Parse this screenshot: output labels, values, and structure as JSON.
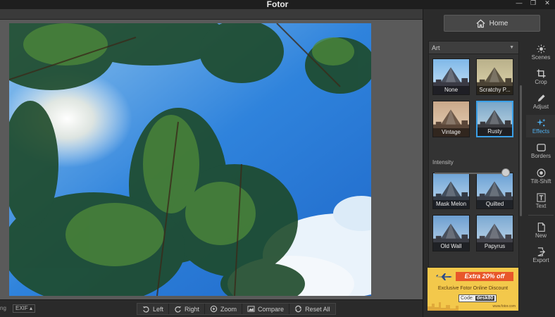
{
  "window": {
    "title": "Fotor",
    "controls": [
      "—",
      "❐",
      "✕"
    ]
  },
  "home": {
    "label": "Home"
  },
  "effects_panel": {
    "category": "Art",
    "intensity_label": "Intensity",
    "intensity": 0.95,
    "thumbnails": [
      {
        "label": "None",
        "tone": "none",
        "selected": false
      },
      {
        "label": "Scratchy P...",
        "tone": "scratchy",
        "selected": false
      },
      {
        "label": "Vintage",
        "tone": "vintage",
        "selected": false
      },
      {
        "label": "Rusty",
        "tone": "rusty",
        "selected": true
      },
      {
        "label": "Mask Melon",
        "tone": "melon",
        "selected": false
      },
      {
        "label": "Quilted",
        "tone": "quilted",
        "selected": false
      },
      {
        "label": "Old Wall",
        "tone": "oldwall",
        "selected": false
      },
      {
        "label": "Papyrus",
        "tone": "papyrus",
        "selected": false
      }
    ]
  },
  "ad": {
    "headline": "Extra 20% off",
    "subtext": "Exclusive Fotor Online Discount",
    "code_label": "Code:",
    "code_value": "desk80",
    "url": "www.fotor.com"
  },
  "sidenav": [
    {
      "label": "Scenes",
      "icon": "sun-icon",
      "active": false
    },
    {
      "label": "Crop",
      "icon": "crop-icon",
      "active": false
    },
    {
      "label": "Adjust",
      "icon": "pencil-icon",
      "active": false
    },
    {
      "label": "Effects",
      "icon": "sparkle-icon",
      "active": true
    },
    {
      "label": "Borders",
      "icon": "frame-icon",
      "active": false
    },
    {
      "label": "Tilt-Shift",
      "icon": "target-icon",
      "active": false
    },
    {
      "label": "Text",
      "icon": "text-icon",
      "active": false
    },
    {
      "label": "New",
      "icon": "new-file-icon",
      "active": false
    },
    {
      "label": "Export",
      "icon": "export-icon",
      "active": false
    }
  ],
  "bottombar": {
    "left_text": "ng",
    "exif": "EXIF ▴",
    "tools": [
      {
        "label": "Left",
        "icon": "rotate-left-icon"
      },
      {
        "label": "Right",
        "icon": "rotate-right-icon"
      },
      {
        "label": "Zoom",
        "icon": "zoom-icon"
      },
      {
        "label": "Compare",
        "icon": "compare-icon"
      },
      {
        "label": "Reset All",
        "icon": "reset-icon"
      }
    ]
  },
  "colors": {
    "accent": "#3aa0e8",
    "active_nav_text": "#4fb0f0",
    "panel_bg": "#2b2b2b",
    "canvas_bg": "#5a5a5a"
  }
}
